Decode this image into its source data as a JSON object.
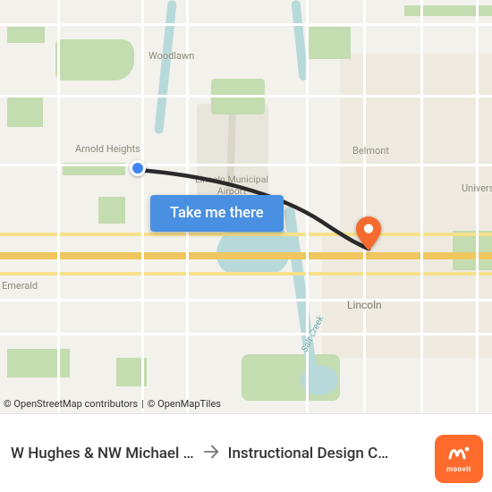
{
  "colors": {
    "route": "#2a2a2a",
    "marker_blue": "#4285f4",
    "marker_orange": "#f56a2e",
    "cta_bg": "#4a90e2",
    "moovit_orange": "#ff6b2d"
  },
  "cta": {
    "label": "Take me there"
  },
  "map_labels": {
    "woodlawn": "Woodlawn",
    "arnold_heights": "Arnold Heights",
    "airport": "Lincoln Municipal\nAirport",
    "belmont": "Belmont",
    "university": "Univers",
    "emerald": "Emerald",
    "lincoln": "Lincoln",
    "salt_creek": "Salt Creek"
  },
  "route": {
    "from": "W Hughes & NW Michael …",
    "to": "Instructional Design C…"
  },
  "attribution": {
    "osm": "© OpenStreetMap contributors",
    "separator": "|",
    "tiles": "© OpenMapTiles"
  },
  "badge": {
    "text": "moovit"
  }
}
